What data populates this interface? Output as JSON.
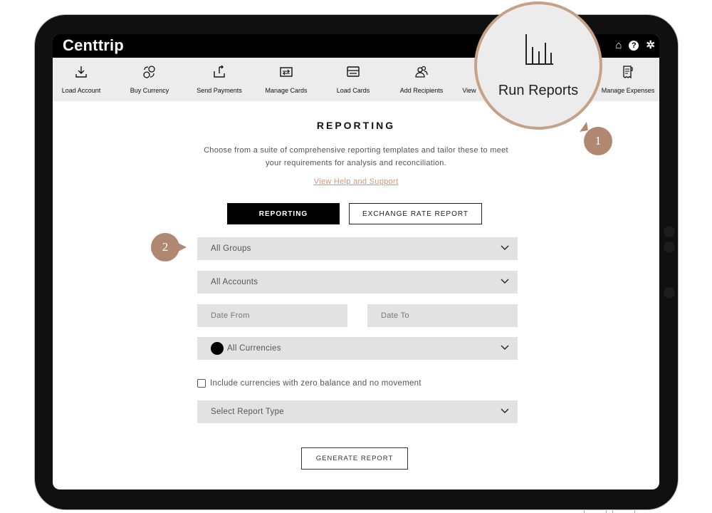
{
  "app": {
    "brand": "Centtrip"
  },
  "toolbar": {
    "items": [
      {
        "label": "Load Account",
        "icon": "download-icon"
      },
      {
        "label": "Buy Currency",
        "icon": "currency-exchange-icon"
      },
      {
        "label": "Send Payments",
        "icon": "share-upload-icon"
      },
      {
        "label": "Manage Cards",
        "icon": "card-transfer-icon"
      },
      {
        "label": "Load Cards",
        "icon": "card-icon"
      },
      {
        "label": "Add Recipients",
        "icon": "users-icon"
      },
      {
        "label": "View",
        "icon": "view-icon"
      },
      {
        "label": "Manage Expenses",
        "icon": "receipt-icon"
      }
    ]
  },
  "header_icons": [
    "home-icon",
    "help-icon",
    "gear-icon"
  ],
  "main": {
    "title": "REPORTING",
    "description": "Choose from a suite of comprehensive reporting templates and tailor these to meet your requirements for analysis and reconciliation.",
    "help_link": "View Help and Support",
    "tabs": [
      {
        "label": "REPORTING",
        "active": true
      },
      {
        "label": "EXCHANGE RATE REPORT",
        "active": false
      }
    ],
    "form": {
      "groups": "All Groups",
      "accounts": "All Accounts",
      "date_from": "Date From",
      "date_to": "Date To",
      "currencies": "All Currencies",
      "zero_balance_label": "Include currencies with zero balance and no movement",
      "zero_balance_checked": false,
      "report_type": "Select Report Type"
    },
    "generate_button": "GENERATE REPORT"
  },
  "callouts": {
    "magnified_label": "Run Reports",
    "step_1": "1",
    "step_2": "2"
  },
  "colors": {
    "accent": "#d4967a",
    "marker": "#b08770",
    "magnifier_ring": "#c5a287",
    "header": "#000000",
    "toolbar": "#ececec",
    "field": "#e2e2e2"
  }
}
